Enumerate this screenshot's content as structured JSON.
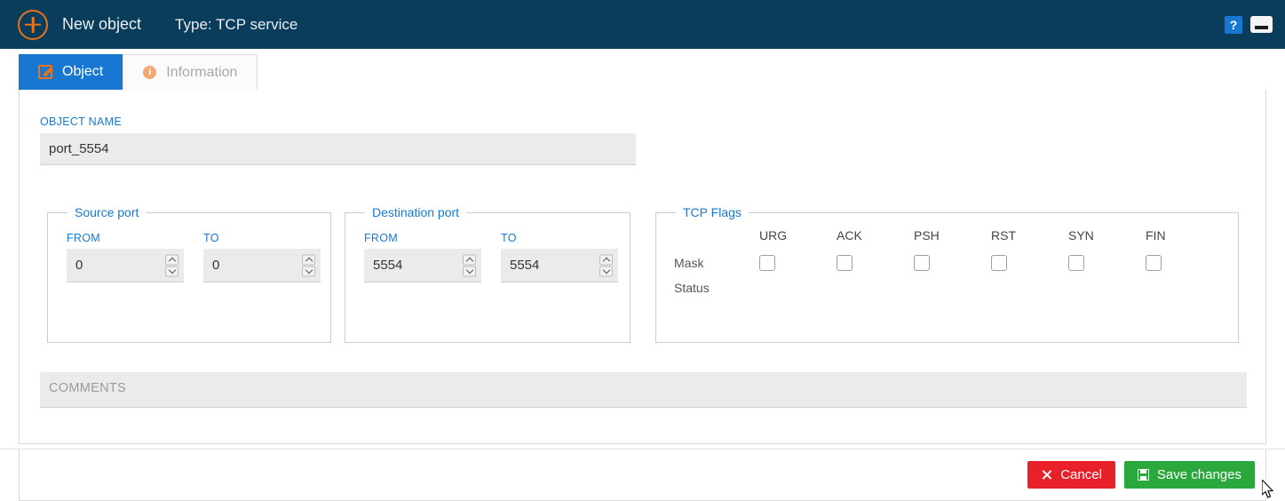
{
  "titlebar": {
    "add_icon": "plus-circle-icon",
    "title": "New object",
    "type_label": "Type: TCP service",
    "help_label": "?",
    "minimize_label": "",
    "bg_color": "#0a3d5c",
    "accent_color": "#e8731a"
  },
  "tabs": [
    {
      "label": "Object",
      "icon": "edit-icon",
      "active": true
    },
    {
      "label": "Information",
      "icon": "info-icon",
      "active": false
    }
  ],
  "form": {
    "object_name": {
      "label": "OBJECT NAME",
      "value": "port_5554",
      "placeholder": ""
    },
    "source_port": {
      "legend": "Source port",
      "from_label": "FROM",
      "from_value": "0",
      "to_label": "TO",
      "to_value": "0"
    },
    "destination_port": {
      "legend": "Destination port",
      "from_label": "FROM",
      "from_value": "5554",
      "to_label": "TO",
      "to_value": "5554"
    },
    "tcp_flags": {
      "legend": "TCP Flags",
      "columns": [
        "URG",
        "ACK",
        "PSH",
        "RST",
        "SYN",
        "FIN"
      ],
      "rows": [
        {
          "label": "Mask",
          "checkboxes": [
            false,
            false,
            false,
            false,
            false,
            false
          ]
        },
        {
          "label": "Status",
          "checkboxes": []
        }
      ]
    },
    "comments": {
      "placeholder": "COMMENTS",
      "value": ""
    }
  },
  "footer": {
    "cancel_label": "Cancel",
    "cancel_icon": "x-icon",
    "cancel_color": "#e8202a",
    "save_label": "Save changes",
    "save_icon": "floppy-disk-icon",
    "save_color": "#2aa83c"
  },
  "colors": {
    "label_blue": "#1878d1",
    "panel_border": "#d9d9d9",
    "input_bg": "#ebebeb"
  }
}
